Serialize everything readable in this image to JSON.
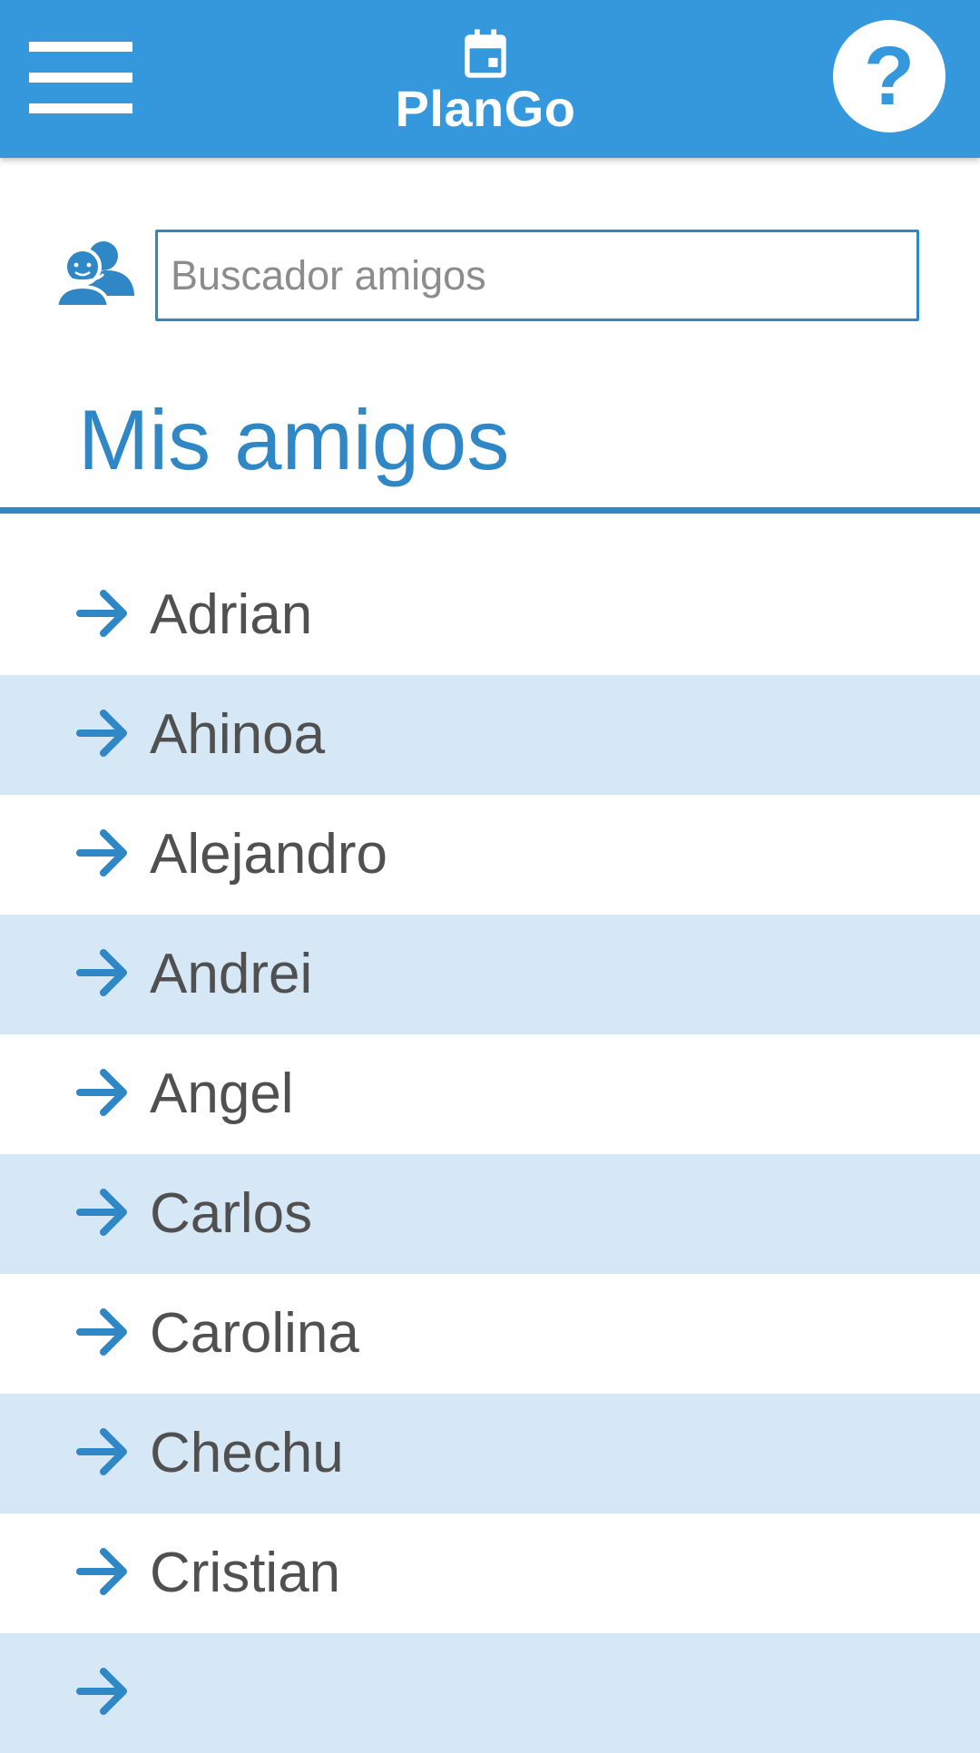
{
  "app": {
    "title": "PlanGo",
    "accent_color": "#3598dc",
    "header_icons": {
      "menu": "hamburger-menu-icon",
      "logo": "calendar-icon",
      "help": "question-mark-icon"
    },
    "help_label": "?"
  },
  "search": {
    "icon": "friends-icon",
    "placeholder": "Buscador amigos",
    "value": ""
  },
  "section": {
    "title": "Mis amigos",
    "title_color": "#2f87c6"
  },
  "friends": [
    "Adrian",
    "Ahinoa",
    "Alejandro",
    "Andrei",
    "Angel",
    "Carlos",
    "Carolina",
    "Chechu",
    "Cristian",
    ""
  ],
  "list_item_icon": "arrow-right-icon",
  "row_alt_color": "#d6e7f5"
}
